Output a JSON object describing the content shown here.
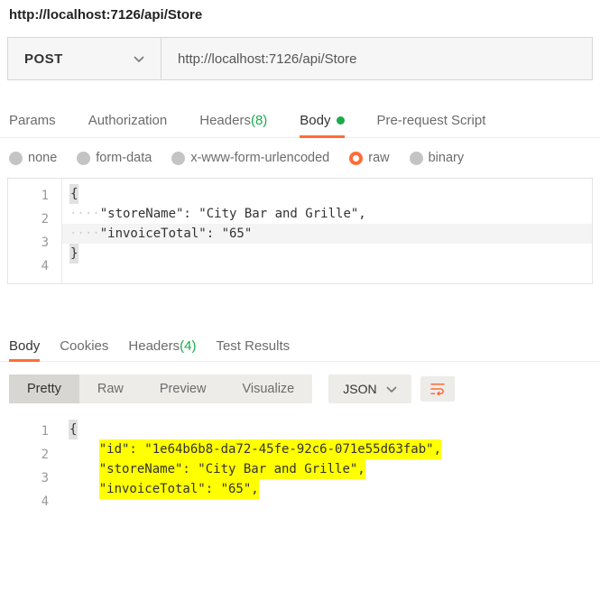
{
  "header": {
    "url_display": "http://localhost:7126/api/Store"
  },
  "request": {
    "method": "POST",
    "url": "http://localhost:7126/api/Store"
  },
  "tabs": {
    "params": "Params",
    "auth": "Authorization",
    "headers_label": "Headers ",
    "headers_count": "(8)",
    "body": "Body",
    "pre_request": "Pre-request Script"
  },
  "body_types": {
    "none": "none",
    "form_data": "form-data",
    "urlencoded": "x-www-form-urlencoded",
    "raw": "raw",
    "binary": "binary"
  },
  "request_body": {
    "lines": [
      "1",
      "2",
      "3",
      "4"
    ],
    "line1": "{",
    "indent": "····",
    "line2": "\"storeName\": \"City Bar and Grille\",",
    "line3": "\"invoiceTotal\": \"65\"",
    "line4": "}"
  },
  "response_tabs": {
    "body": "Body",
    "cookies": "Cookies",
    "headers_label": "Headers ",
    "headers_count": "(4)",
    "tests": "Test Results"
  },
  "view_modes": {
    "pretty": "Pretty",
    "raw": "Raw",
    "preview": "Preview",
    "visualize": "Visualize",
    "json": "JSON"
  },
  "response_body": {
    "lines": [
      "1",
      "2",
      "3",
      "4"
    ],
    "line1": "{",
    "indent": "    ",
    "line2": "\"id\": \"1e64b6b8-da72-45fe-92c6-071e55d63fab\",",
    "line3": "\"storeName\": \"City Bar and Grille\",",
    "line4": "\"invoiceTotal\": \"65\","
  }
}
